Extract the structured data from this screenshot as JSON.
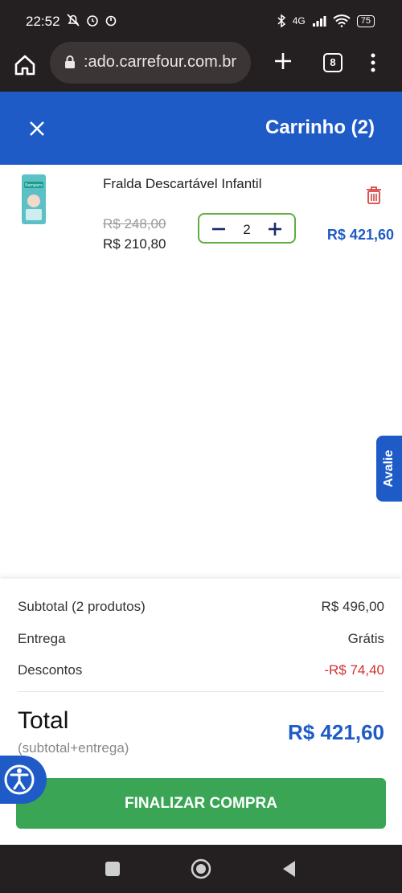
{
  "status_bar": {
    "time": "22:52",
    "network": "4G",
    "battery": "75"
  },
  "browser": {
    "url": ":ado.carrefour.com.br",
    "tab_count": "8"
  },
  "header": {
    "title": "Carrinho (2)"
  },
  "cart_item": {
    "name": "Fralda Descartável Infantil",
    "old_price": "R$ 248,00",
    "price": "R$ 210,80",
    "quantity": "2",
    "line_total": "R$ 421,60",
    "thumbnail_label": "Pampers"
  },
  "feedback_tab": {
    "label": "Avalie"
  },
  "summary": {
    "subtotal_label": "Subtotal (2 produtos)",
    "subtotal_value": "R$ 496,00",
    "delivery_label": "Entrega",
    "delivery_value": "Grátis",
    "discount_label": "Descontos",
    "discount_value": "-R$ 74,40",
    "total_label": "Total",
    "total_sub": "(subtotal+entrega)",
    "total_value": "R$ 421,60",
    "checkout_label": "FINALIZAR COMPRA"
  },
  "colors": {
    "brand_blue": "#1e5bc6",
    "checkout_green": "#3aa655",
    "discount_red": "#d32f2f",
    "stepper_border": "#5fae41"
  }
}
